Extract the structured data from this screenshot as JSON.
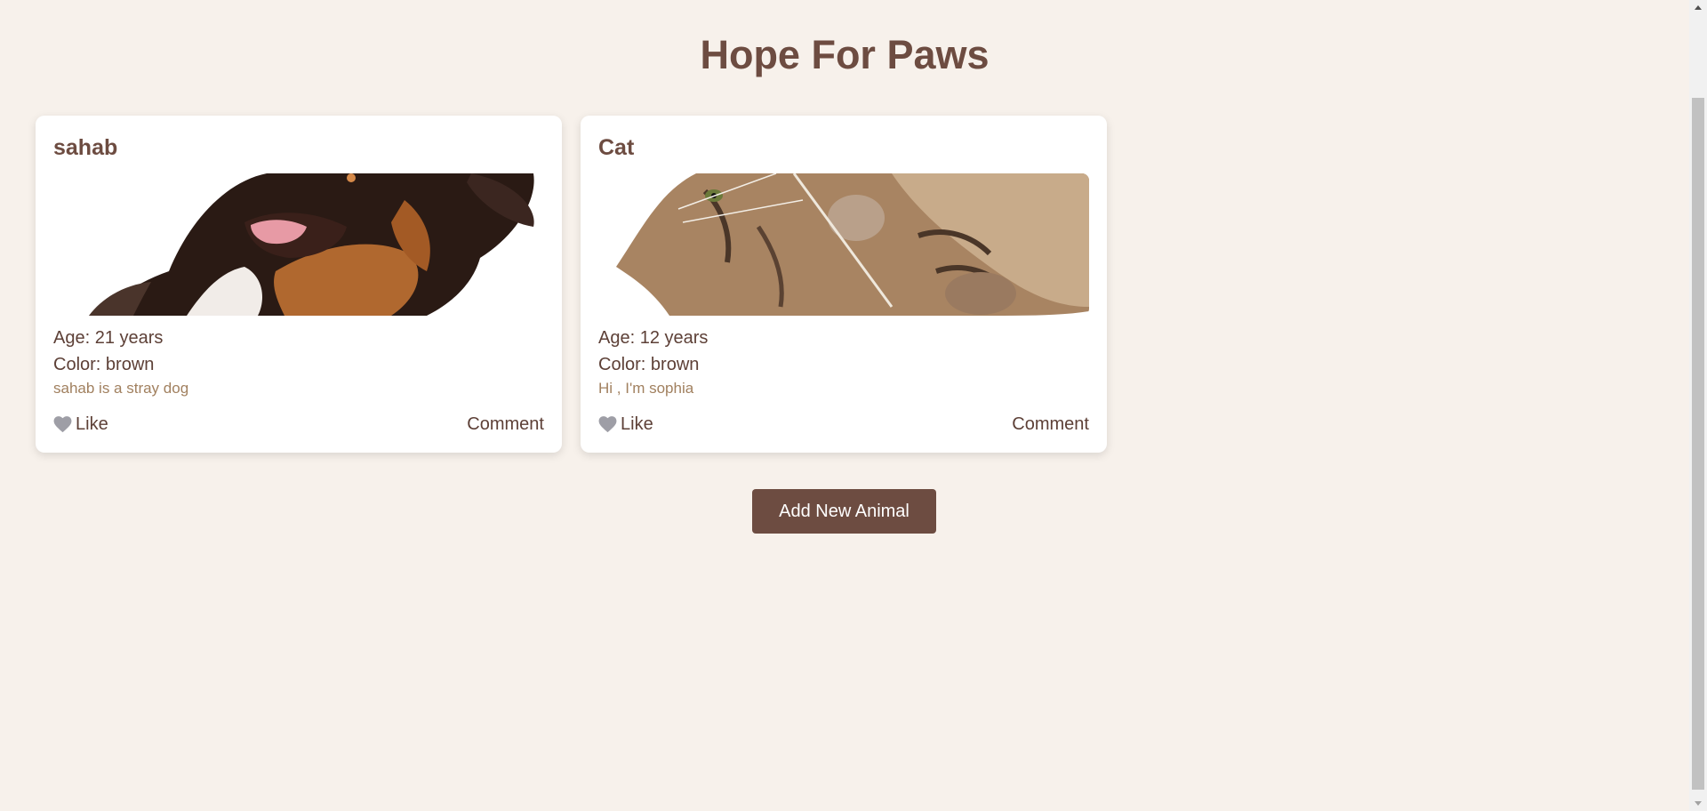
{
  "header": {
    "title": "Hope For Paws"
  },
  "animals": [
    {
      "name": "sahab",
      "age": "Age: 21 years",
      "color": "Color: brown",
      "description": "sahab is a stray dog",
      "like_label": "Like",
      "comment_label": "Comment",
      "image_icon": "dog-photo"
    },
    {
      "name": "Cat",
      "age": "Age: 12 years",
      "color": "Color: brown",
      "description": "Hi , I'm sophia",
      "like_label": "Like",
      "comment_label": "Comment",
      "image_icon": "cat-photo"
    }
  ],
  "actions": {
    "add_label": "Add New Animal"
  },
  "theme": {
    "background": "#f7f1eb",
    "accent": "#6d4c41",
    "heart": "#9e9ea6",
    "description": "#a1805f"
  }
}
